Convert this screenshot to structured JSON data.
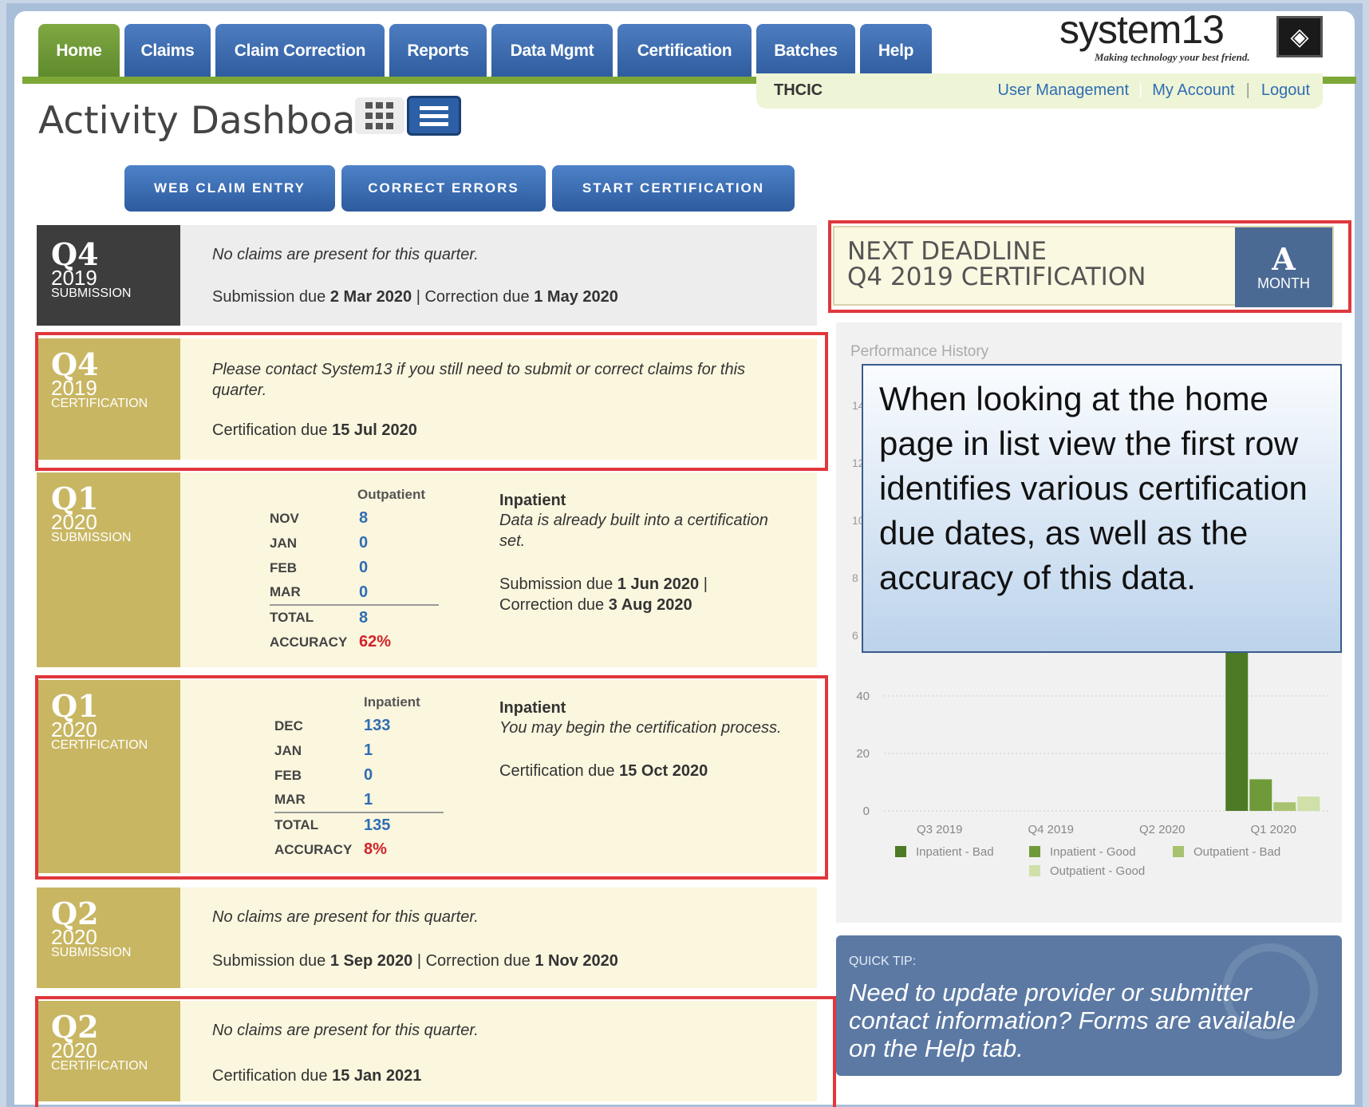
{
  "nav": {
    "tabs": [
      "Home",
      "Claims",
      "Claim Correction",
      "Reports",
      "Data Mgmt",
      "Certification",
      "Batches",
      "Help"
    ],
    "active": "Home"
  },
  "logo": {
    "name": "system13",
    "tagline": "Making technology your best friend."
  },
  "subbar": {
    "org": "THCIC",
    "links": [
      "User Management",
      "My Account",
      "Logout"
    ]
  },
  "page": {
    "title": "Activity Dashboard",
    "view_icons": [
      "grid-view-icon",
      "list-view-icon"
    ],
    "actions": [
      "WEB CLAIM ENTRY",
      "CORRECT ERRORS",
      "START CERTIFICATION"
    ]
  },
  "rows": [
    {
      "q": "Q4",
      "year": "2019",
      "kind": "SUBMISSION",
      "message": "No claims are present for this quarter.",
      "due": {
        "sub_label": "Submission due ",
        "sub_date": "2 Mar 2020",
        "sep": " | ",
        "cor_label": "Correction due ",
        "cor_date": "1 May 2020"
      }
    },
    {
      "q": "Q4",
      "year": "2019",
      "kind": "CERTIFICATION",
      "message": "Please contact System13 if you still need to submit or correct claims for this quarter.",
      "due": {
        "label": "Certification due ",
        "date": "15 Jul 2020"
      }
    },
    {
      "q": "Q1",
      "year": "2020",
      "kind": "SUBMISSION",
      "header": "Outpatient",
      "months": [
        [
          "NOV",
          "8"
        ],
        [
          "JAN",
          "0"
        ],
        [
          "FEB",
          "0"
        ],
        [
          "MAR",
          "0"
        ]
      ],
      "total_label": "TOTAL",
      "total": "8",
      "accuracy_label": "ACCURACY",
      "accuracy": "62%",
      "right_title": "Inpatient",
      "right_msg": "Data is already built into a certification set.",
      "due": {
        "sub_label": "Submission due ",
        "sub_date": "1 Jun 2020",
        "sep": " |",
        "cor_label": "Correction due ",
        "cor_date": "3 Aug 2020"
      }
    },
    {
      "q": "Q1",
      "year": "2020",
      "kind": "CERTIFICATION",
      "header": "Inpatient",
      "months": [
        [
          "DEC",
          "133"
        ],
        [
          "JAN",
          "1"
        ],
        [
          "FEB",
          "0"
        ],
        [
          "MAR",
          "1"
        ]
      ],
      "total_label": "TOTAL",
      "total": "135",
      "accuracy_label": "ACCURACY",
      "accuracy": "8%",
      "right_title": "Inpatient",
      "right_msg": "You may begin the certification process.",
      "due": {
        "label": "Certification due ",
        "date": "15 Oct 2020"
      }
    },
    {
      "q": "Q2",
      "year": "2020",
      "kind": "SUBMISSION",
      "message": "No claims are present for this quarter.",
      "due": {
        "sub_label": "Submission due ",
        "sub_date": "1 Sep 2020",
        "sep": " | ",
        "cor_label": "Correction due ",
        "cor_date": "1 Nov 2020"
      }
    },
    {
      "q": "Q2",
      "year": "2020",
      "kind": "CERTIFICATION",
      "message": "No claims are present for this quarter.",
      "due": {
        "label": "Certification due ",
        "date": "15 Jan 2021"
      }
    }
  ],
  "deadline": {
    "line1": "NEXT DEADLINE",
    "line2": "Q4 2019 CERTIFICATION",
    "grade": "A",
    "unit": "MONTH"
  },
  "performance": {
    "title": "Performance History",
    "partial_ticks": [
      "14",
      "12",
      "10",
      "8",
      "6"
    ]
  },
  "chart_data": {
    "type": "bar",
    "categories": [
      "Q3 2019",
      "Q4 2019",
      "Q2 2020",
      "Q1 2020"
    ],
    "series": [
      {
        "name": "Inpatient - Bad",
        "values": [
          0,
          0,
          0,
          122
        ],
        "color": "#4d7a25"
      },
      {
        "name": "Inpatient - Good",
        "values": [
          0,
          0,
          0,
          11
        ],
        "color": "#6f9a3a"
      },
      {
        "name": "Outpatient - Bad",
        "values": [
          0,
          0,
          0,
          3
        ],
        "color": "#a7c36f"
      },
      {
        "name": "Outpatient - Good",
        "values": [
          0,
          0,
          0,
          5
        ],
        "color": "#cfe0a8"
      }
    ],
    "yticks": [
      "0",
      "20",
      "40"
    ],
    "ylim": [
      0,
      140
    ],
    "grid": true,
    "legend": "bottom"
  },
  "callout": {
    "text": "When looking at the home page in list view the first row identifies various certification due dates, as well as the accuracy of this data."
  },
  "tip": {
    "label": "QUICK TIP:",
    "text": "Need to update provider or submitter contact information? Forms are available on the Help tab."
  }
}
